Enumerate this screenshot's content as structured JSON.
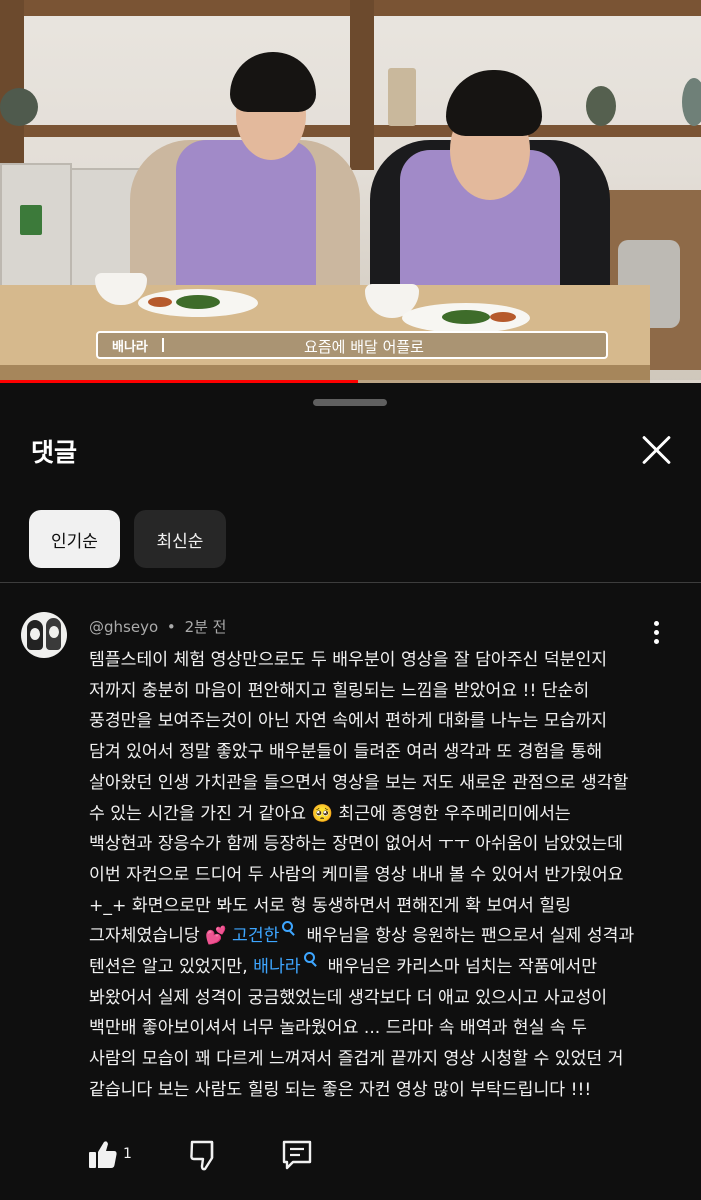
{
  "video": {
    "subtitle_speaker": "배나라",
    "subtitle_text": "요즘에 배달 어플로",
    "progress": 0.51
  },
  "panel": {
    "title": "댓글",
    "sort_chips": [
      {
        "label": "인기순",
        "active": true
      },
      {
        "label": "최신순",
        "active": false
      }
    ]
  },
  "comment": {
    "author": "@ghseyo",
    "separator": "•",
    "time": "2분 전",
    "lines": [
      "템플스테이 체험 영상만으로도 두 배우분이 영상을 잘 담아주신 덕분인지",
      "저까지 충분히 마음이 편안해지고 힐링되는 느낌을 받았어요 !! 단순히",
      "풍경만을 보여주는것이 아닌 자연 속에서 편하게 대화를 나누는 모습까지",
      "담겨 있어서 정말 좋았구 배우분들이 들려준 여러 생각과 또 경험을 통해",
      "살아왔던 인생 가치관을 들으면서 영상을 보는 저도 새로운 관점으로 생각할",
      "수 있는 시간을 가진 거 같아요 🥺 최근에 종영한 우주메리미에서는",
      "백상현과 장응수가 함께 등장하는 장면이 없어서 ㅜㅜ 아쉬움이 남았었는데",
      "이번 자컨으로 드디어 두 사람의 케미를 영상 내내 볼 수 있어서 반가웠어요",
      "+_+ 화면으로만 봐도 서로 형 동생하면서 편해진게 확 보여서 힐링"
    ],
    "line10_pre": "그자체였습니당 💕 ",
    "mention1": "고건한",
    "line10_post": "배우님을 항상 응원하는 팬으로서 실제 성격과",
    "line11_pre": "텐션은 알고 있었지만, ",
    "mention2": "배나라",
    "line11_post": "배우님은 카리스마 넘치는 작품에서만",
    "lines_tail": [
      "봐왔어서 실제 성격이 궁금했었는데 생각보다 더 애교 있으시고 사교성이",
      "백만배 좋아보이셔서 너무 놀라웠어요 ... 드라마 속 배역과 현실 속 두",
      "사람의 모습이 꽤 다르게 느껴져서 즐겁게 끝까지 영상 시청할 수 있었던 거",
      "같습니다 보는 사람도 힐링 되는 좋은 자컨 영상 많이 부탁드립니다 !!!"
    ],
    "like_count": "1"
  },
  "icons": {
    "close": "close-icon",
    "more": "more-vert-icon",
    "like": "thumbs-up-icon",
    "dislike": "thumbs-down-icon",
    "reply": "reply-comment-icon"
  },
  "colors": {
    "background": "#0f0f0f",
    "mention": "#3ea6ff",
    "chip_active": "#f1f1f1",
    "chip_inactive": "#272727",
    "vest": "#a18ac8"
  }
}
